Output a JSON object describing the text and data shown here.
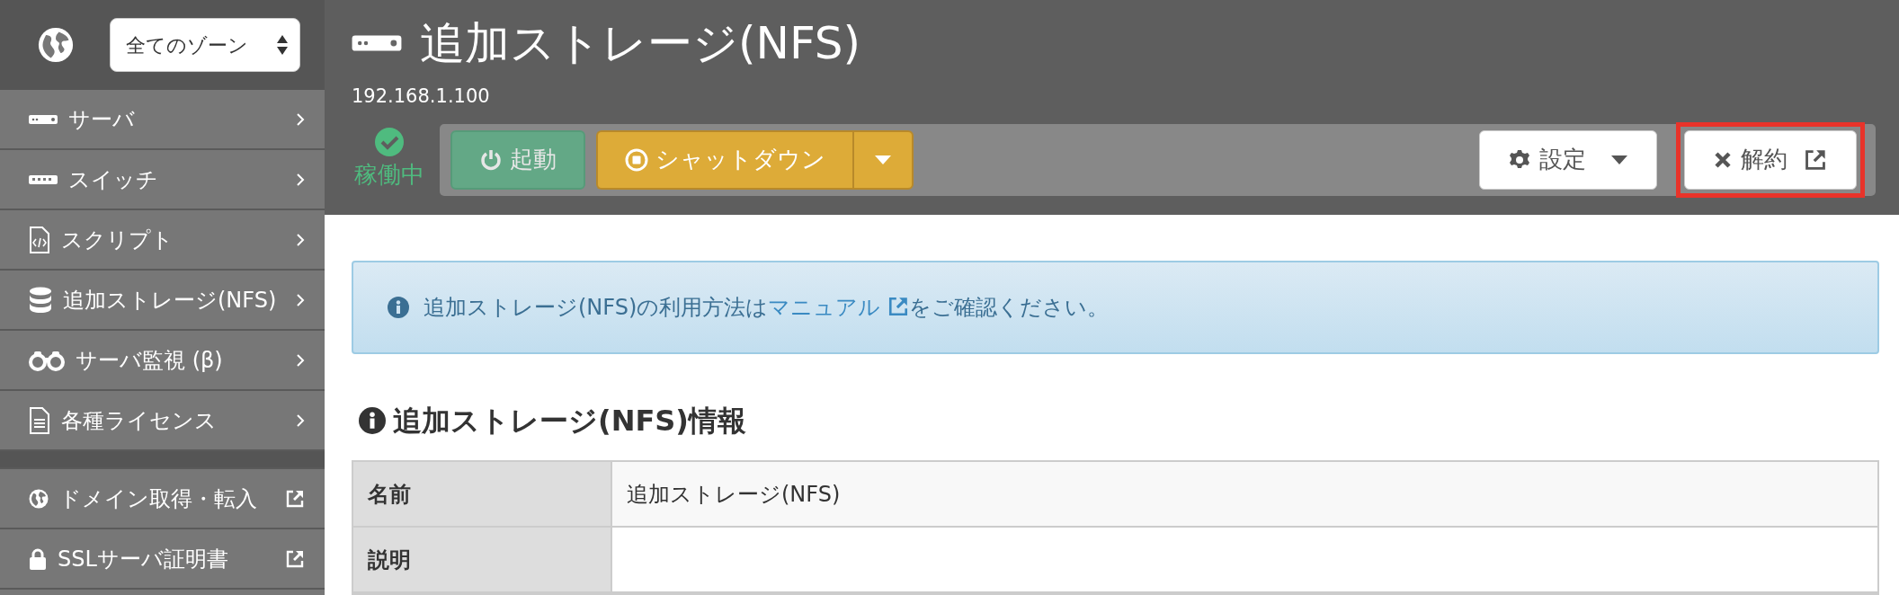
{
  "zone_select": {
    "value": "全てのゾーン"
  },
  "sidebar": {
    "items": [
      {
        "label": "サーバ",
        "kind": "menu"
      },
      {
        "label": "スイッチ",
        "kind": "menu"
      },
      {
        "label": "スクリプト",
        "kind": "menu"
      },
      {
        "label": "追加ストレージ(NFS)",
        "kind": "menu"
      },
      {
        "label": "サーバ監視 (β)",
        "kind": "menu"
      },
      {
        "label": "各種ライセンス",
        "kind": "menu"
      }
    ],
    "external_items": [
      {
        "label": "ドメイン取得・転入",
        "kind": "external"
      },
      {
        "label": "SSLサーバ証明書",
        "kind": "external"
      }
    ]
  },
  "header": {
    "title": "追加ストレージ(NFS)",
    "address": "192.168.1.100"
  },
  "status": {
    "label": "稼働中",
    "running": true
  },
  "toolbar": {
    "buttons": [
      {
        "label": "起動",
        "kind": "start",
        "disabled": true
      },
      {
        "label": "シャットダウン",
        "kind": "shutdown",
        "disabled": false
      }
    ],
    "right_buttons": [
      {
        "label": "設定",
        "kind": "settings",
        "highlighted": false
      },
      {
        "label": "解約",
        "kind": "cancel",
        "highlighted": true
      }
    ]
  },
  "notice": {
    "before": "追加ストレージ(NFS)の利用方法は",
    "link": "マニュアル",
    "after": "をご確認ください。"
  },
  "info": {
    "heading": "追加ストレージ(NFS)情報",
    "rows": [
      {
        "label": "名前",
        "value": "追加ストレージ(NFS)"
      },
      {
        "label": "説明"
      }
    ]
  }
}
